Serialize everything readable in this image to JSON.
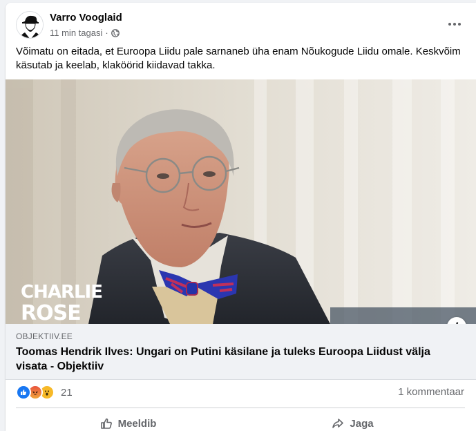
{
  "post": {
    "author": "Varro Vooglaid",
    "time": "11 min tagasi",
    "time_separator": "·",
    "privacy_icon": "globe-icon",
    "text": "Võimatu on eitada, et Euroopa Liidu pale sarnaneb üha enam Nõukogude Liidu omale. Keskvõim käsutab ja keelab, klaköörid kiidavad takka."
  },
  "media": {
    "watermark_line1": "CHARLIE",
    "watermark_line2": "ROSE",
    "info_icon_label": "i"
  },
  "link": {
    "domain": "OBJEKTIIV.EE",
    "title": "Toomas Hendrik Ilves: Ungari on Putini käsilane ja tuleks Euroopa Liidust välja visata - Objektiiv"
  },
  "reactions": {
    "icons": [
      "like-icon",
      "angry-icon",
      "wow-icon"
    ],
    "count": "21",
    "comments": "1 kommentaar"
  },
  "actions": {
    "like_label": "Meeldib",
    "share_label": "Jaga"
  },
  "colors": {
    "like_blue": "#1877f2",
    "angry_orange": "#e9710f",
    "wow_yellow": "#f7b928",
    "secondary_text": "#65676b"
  }
}
